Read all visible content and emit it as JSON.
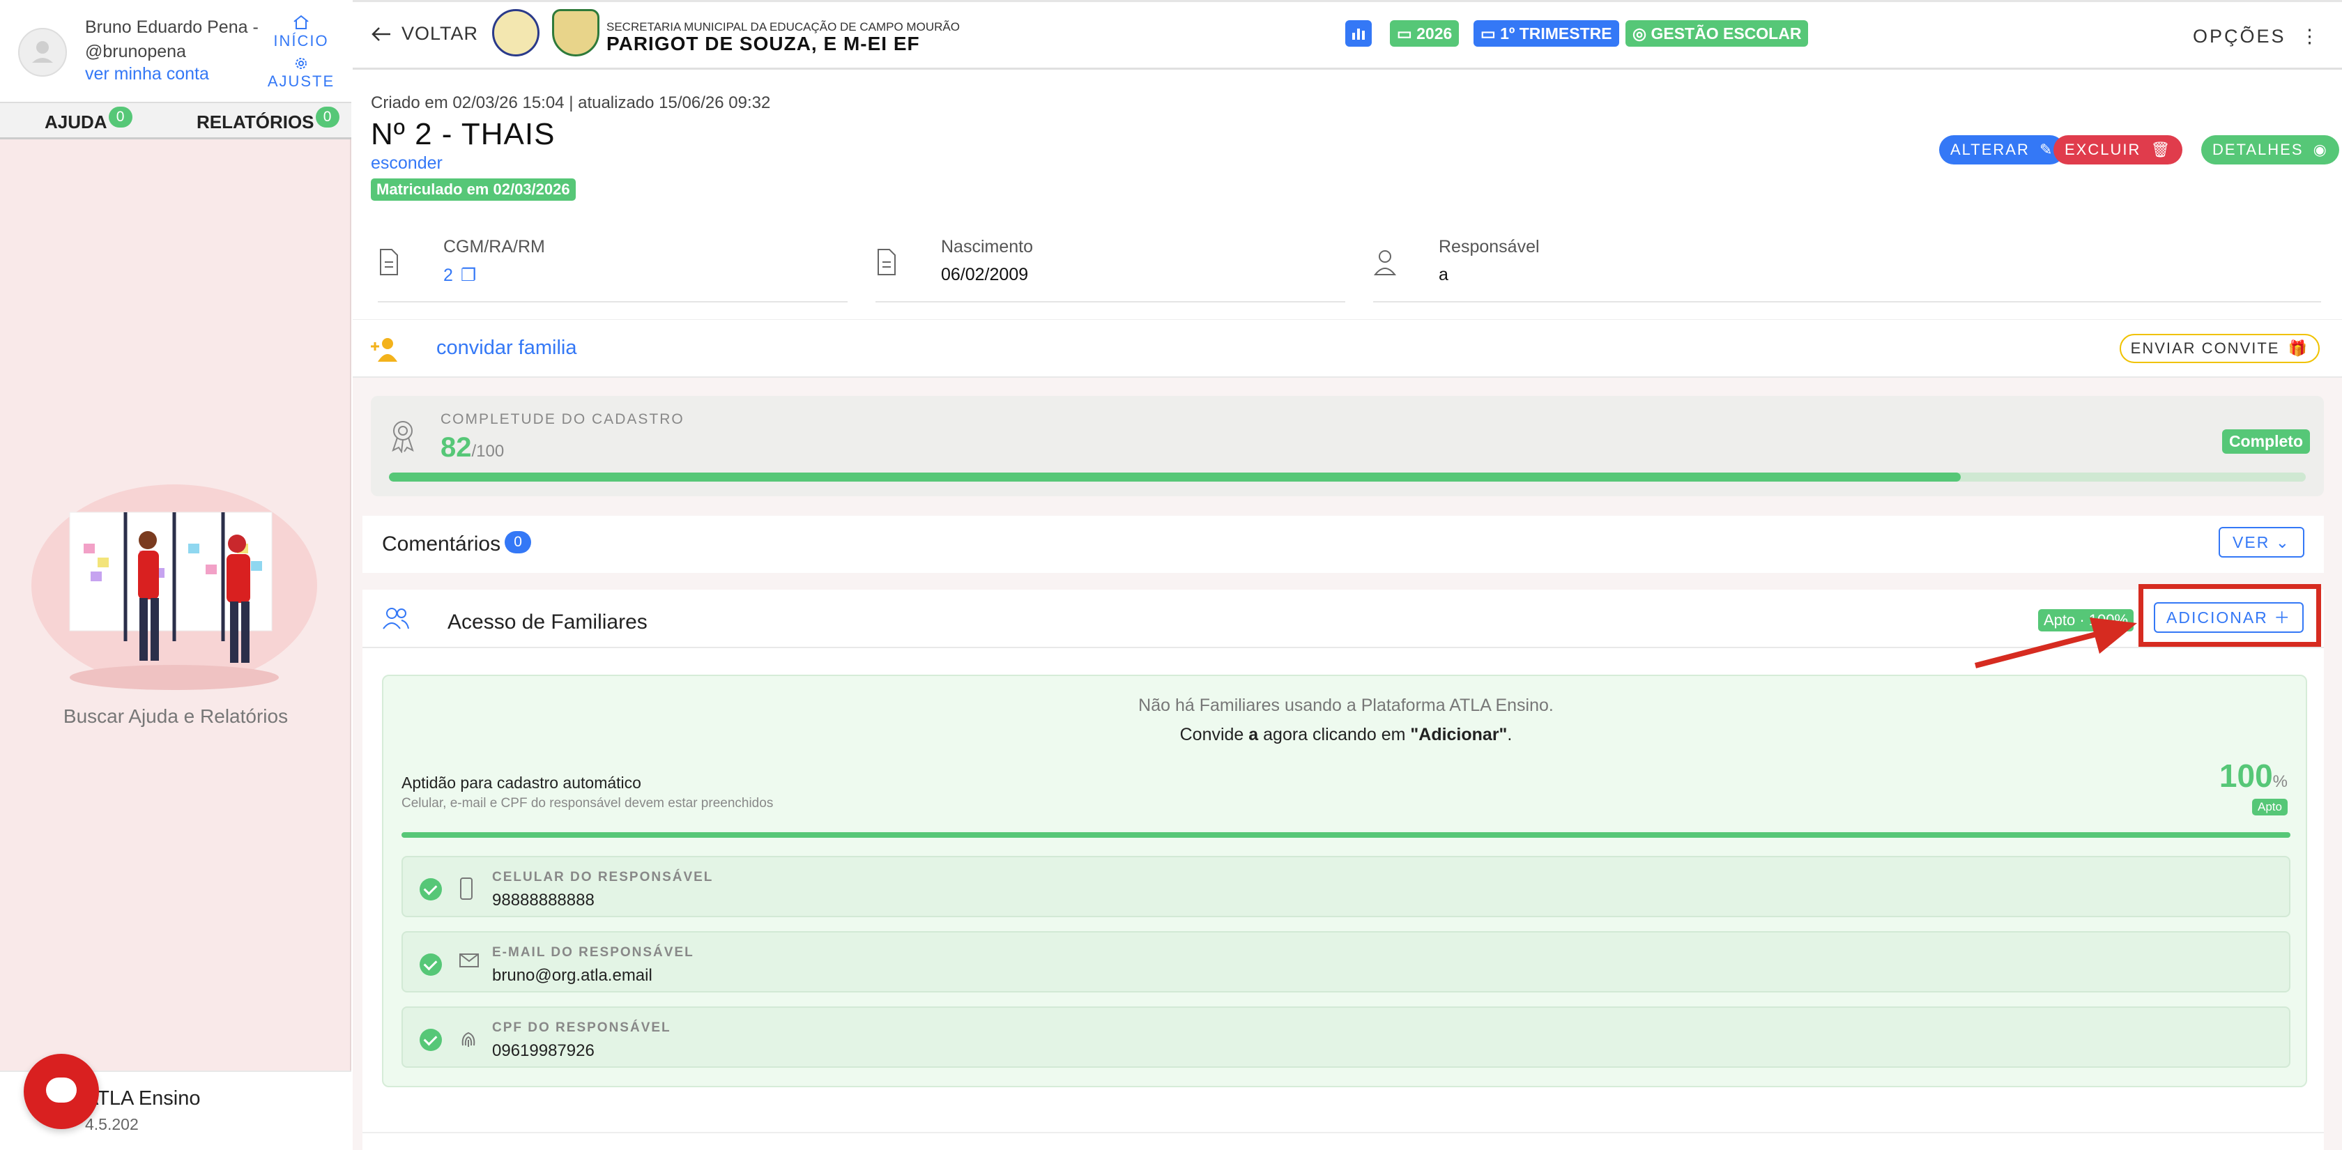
{
  "sidebar": {
    "user_name": "Bruno Eduardo Pena - @brunopena",
    "account_link": "ver minha conta",
    "home_label": "INÍCIO",
    "settings_label": "AJUSTE",
    "tabs": [
      {
        "label": "AJUDA",
        "count": "0"
      },
      {
        "label": "RELATÓRIOS",
        "count": "0"
      }
    ],
    "help_caption": "Buscar Ajuda e Relatórios",
    "app_name": "ATLA Ensino",
    "app_version": "4.5.202"
  },
  "topbar": {
    "back_label": "VOLTAR",
    "secretaria": "SECRETARIA MUNICIPAL DA EDUCAÇÃO DE CAMPO MOURÃO",
    "school": "PARIGOT DE SOUZA, E M-EI EF",
    "chips": {
      "year": "2026",
      "term": "1º TRIMESTRE",
      "management": "GESTÃO ESCOLAR"
    },
    "options_label": "OPÇÕES"
  },
  "header": {
    "created": "Criado em 02/03/26 15:04 | atualizado 15/06/26 09:32",
    "student": "Nº 2 - THAIS",
    "hide_link": "esconder",
    "enrolled": "Matriculado em 02/03/2026",
    "buttons": {
      "edit": "ALTERAR",
      "delete": "EXCLUIR",
      "details": "DETALHES"
    }
  },
  "fields": [
    {
      "label": "CGM/RA/RM",
      "value": "2"
    },
    {
      "label": "Nascimento",
      "value": "06/02/2009"
    },
    {
      "label": "Responsável",
      "value": "a"
    }
  ],
  "invite": {
    "link": "convidar familia",
    "button": "ENVIAR CONVITE"
  },
  "completeness": {
    "label": "COMPLETUDE DO CADASTRO",
    "score": "82",
    "total": "/100",
    "score_fraction": 0.82,
    "badge": "Completo"
  },
  "comments": {
    "title": "Comentários",
    "count": "0",
    "button": "VER"
  },
  "family_access": {
    "title": "Acesso de Familiares",
    "status_chip": "Apto · 100%",
    "add_button": "ADICIONAR",
    "empty_message": "Não há Familiares usando a Plataforma ATLA Ensino.",
    "invite_pre": "Convide",
    "invite_bold": "a",
    "invite_mid": "agora clicando em",
    "invite_quote": "\"Adicionar\"",
    "invite_end": ".",
    "aptidao_title": "Aptidão para cadastro automático",
    "aptidao_subtitle": "Celular, e-mail e CPF do responsável devem estar preenchidos",
    "percent": "100",
    "percent_unit": "%",
    "apto_label": "Apto",
    "items": [
      {
        "label": "CELULAR DO RESPONSÁVEL",
        "value": "98888888888",
        "icon": "phone-icon"
      },
      {
        "label": "E-MAIL DO RESPONSÁVEL",
        "value": "bruno@org.atla.email",
        "icon": "mail-icon"
      },
      {
        "label": "CPF DO RESPONSÁVEL",
        "value": "09619987926",
        "icon": "fingerprint-icon"
      }
    ]
  },
  "colors": {
    "primary": "#3478f6",
    "success": "#56c777",
    "danger": "#e03c4c",
    "highlight": "#d62b20"
  }
}
